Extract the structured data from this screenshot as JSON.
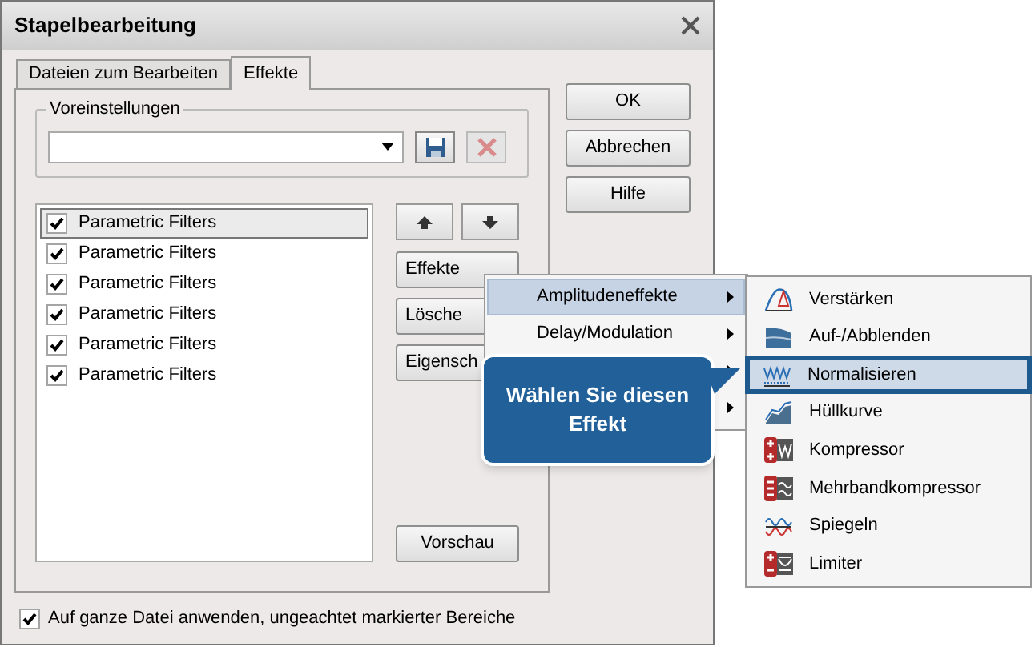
{
  "window": {
    "title": "Stapelbearbeitung"
  },
  "tabs": [
    {
      "label": "Dateien zum Bearbeiten",
      "selected": false
    },
    {
      "label": "Effekte",
      "selected": true
    }
  ],
  "presets": {
    "label": "Voreinstellungen"
  },
  "effects_list": [
    {
      "label": "Parametric Filters",
      "checked": true,
      "selected": true
    },
    {
      "label": "Parametric Filters",
      "checked": true,
      "selected": false
    },
    {
      "label": "Parametric Filters",
      "checked": true,
      "selected": false
    },
    {
      "label": "Parametric Filters",
      "checked": true,
      "selected": false
    },
    {
      "label": "Parametric Filters",
      "checked": true,
      "selected": false
    },
    {
      "label": "Parametric Filters",
      "checked": true,
      "selected": false
    }
  ],
  "side_buttons": [
    "Effekte",
    "Lösche",
    "Eigensch"
  ],
  "preview_button": "Vorschau",
  "dialog_buttons": [
    "OK",
    "Abbrechen",
    "Hilfe"
  ],
  "apply_whole_file": {
    "label": "Auf ganze Datei anwenden, ungeachtet markierter Bereiche",
    "checked": true
  },
  "menu": {
    "items": [
      {
        "label": "Amplitudeneffekte",
        "selected": true
      },
      {
        "label": "Delay/Modulation",
        "selected": false
      },
      {
        "selected": false
      },
      {
        "selected": false
      }
    ]
  },
  "submenu": {
    "items": [
      {
        "label": "Verstärken",
        "selected": false
      },
      {
        "label": "Auf-/Abblenden",
        "selected": false
      },
      {
        "label": "Normalisieren",
        "selected": true
      },
      {
        "label": "Hüllkurve",
        "selected": false
      },
      {
        "label": "Kompressor",
        "selected": false
      },
      {
        "label": "Mehrbandkompressor",
        "selected": false
      },
      {
        "label": "Spiegeln",
        "selected": false
      },
      {
        "label": "Limiter",
        "selected": false
      }
    ]
  },
  "callout": {
    "text": "Wählen Sie diesen Effekt"
  }
}
